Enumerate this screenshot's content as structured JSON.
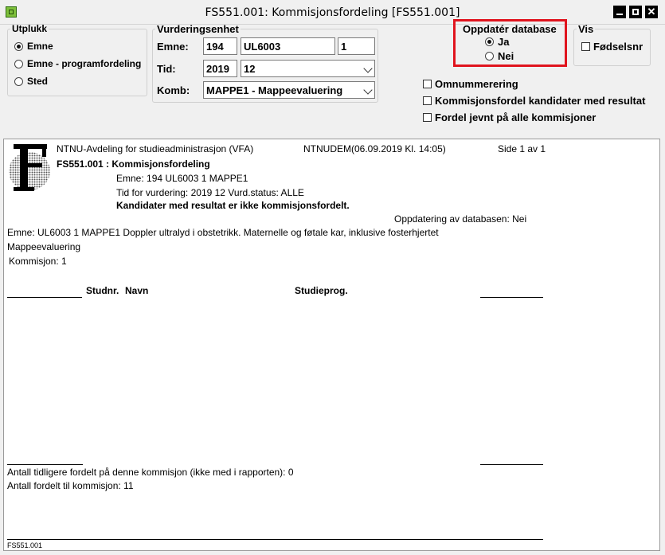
{
  "window": {
    "title": "FS551.001: Kommisjonsfordeling [FS551.001]",
    "app_icon": "app-icon",
    "controls": [
      "minimize-icon",
      "maximize-icon",
      "close-icon"
    ]
  },
  "utplukk": {
    "legend": "Utplukk",
    "options": [
      {
        "label": "Emne",
        "selected": true
      },
      {
        "label": "Emne - programfordeling",
        "selected": false
      },
      {
        "label": "Sted",
        "selected": false
      }
    ]
  },
  "vurderingsenhet": {
    "legend": "Vurderingsenhet",
    "emne_label": "Emne:",
    "emne_inst": "194",
    "emne_kode": "UL6003",
    "emne_versjon": "1",
    "tid_label": "Tid:",
    "tid_ar": "2019",
    "tid_termin": "12",
    "komb_label": "Komb:",
    "komb_value": "MAPPE1 -  Mappeevaluering"
  },
  "oppdater": {
    "legend": "Oppdatér database",
    "options": [
      {
        "label": "Ja",
        "selected": true
      },
      {
        "label": "Nei",
        "selected": false
      }
    ]
  },
  "vis": {
    "legend": "Vis",
    "fodselsnr_label": "Fødselsnr"
  },
  "options": {
    "omnummerering": "Omnummerering",
    "kommisjonsfordel": "Kommisjonsfordel kandidater med resultat",
    "fordel_jevnt": "Fordel jevnt på alle kommisjoner"
  },
  "report": {
    "institution": "NTNU-Avdeling for studieadministrasjon (VFA)",
    "user_stamp": "NTNUDEM(06.09.2019 Kl. 14:05)",
    "page": "Side 1 av 1",
    "report_title": "FS551.001 : Kommisjonsfordeling",
    "emne_line": "Emne: 194 UL6003 1 MAPPE1",
    "tid_line": "Tid for vurdering: 2019 12  Vurd.status: ALLE",
    "note": "Kandidater med resultat er ikke kommisjonsfordelt.",
    "oppdatering": "Oppdatering av databasen:  Nei",
    "emne_desc": "Emne: UL6003 1 MAPPE1 Doppler ultralyd i obstetrikk. Maternelle og føtale kar, inklusive fosterhjertet",
    "mappe": "Mappeevaluering",
    "kommisjon": "Kommisjon: 1",
    "col_studnr": "Studnr.",
    "col_navn": "Navn",
    "col_studieprog": "Studieprog.",
    "tidligere": "Antall tidligere fordelt på denne kommisjon (ikke med i rapporten): 0",
    "fordelt": "Antall fordelt til kommisjon: 11",
    "footer": "FS551.001"
  }
}
